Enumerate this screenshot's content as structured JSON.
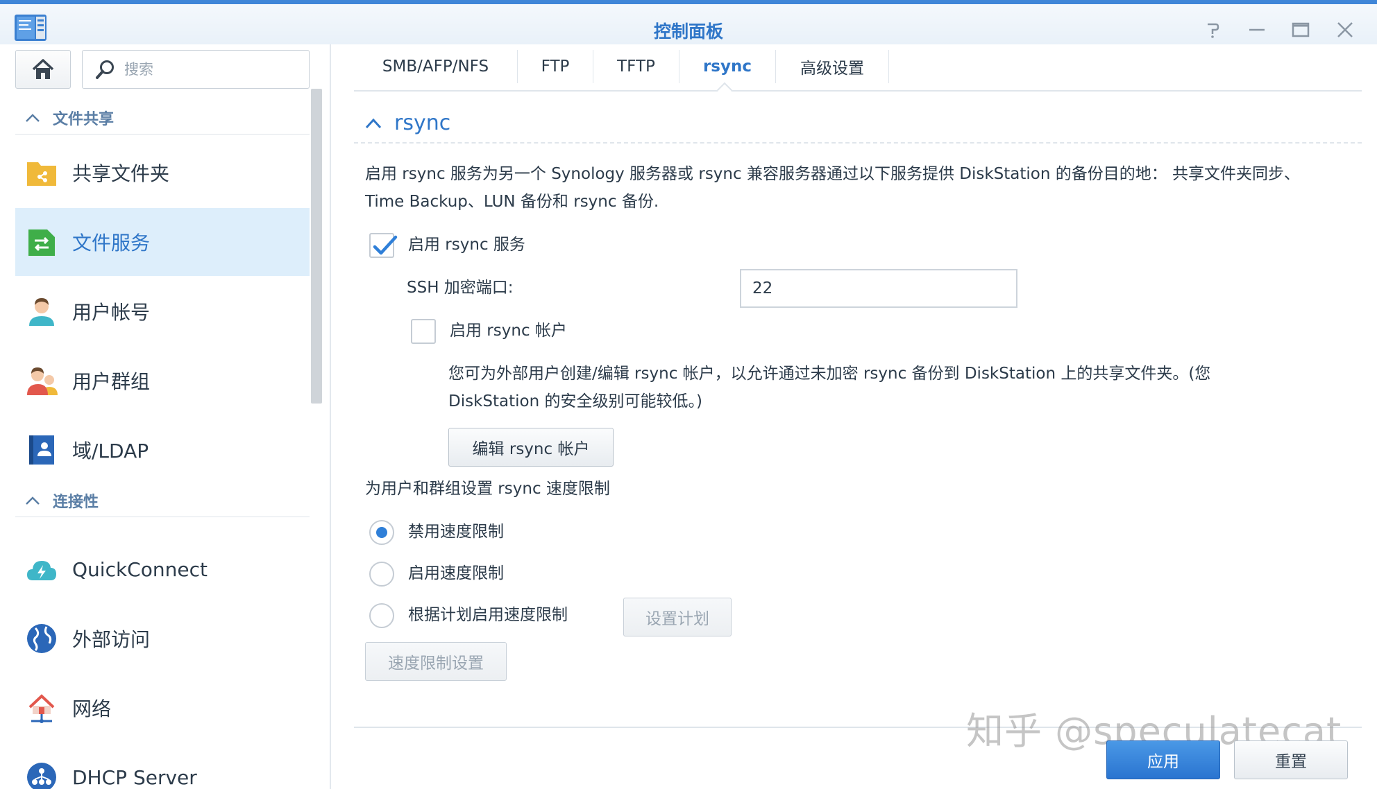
{
  "window": {
    "title": "控制面板"
  },
  "sidebar": {
    "search_placeholder": "搜索",
    "sections": [
      {
        "title": "文件共享",
        "items": [
          {
            "label": "共享文件夹",
            "icon": "shared-folder-icon"
          },
          {
            "label": "文件服务",
            "icon": "file-services-icon",
            "active": true
          },
          {
            "label": "用户帐号",
            "icon": "user-icon"
          },
          {
            "label": "用户群组",
            "icon": "group-icon"
          },
          {
            "label": "域/LDAP",
            "icon": "domain-ldap-icon"
          }
        ]
      },
      {
        "title": "连接性",
        "items": [
          {
            "label": "QuickConnect",
            "icon": "quickconnect-icon"
          },
          {
            "label": "外部访问",
            "icon": "globe-icon"
          },
          {
            "label": "网络",
            "icon": "network-icon"
          },
          {
            "label": "DHCP Server",
            "icon": "dhcp-icon"
          }
        ]
      }
    ]
  },
  "tabs": [
    {
      "label": "SMB/AFP/NFS"
    },
    {
      "label": "FTP"
    },
    {
      "label": "TFTP"
    },
    {
      "label": "rsync",
      "active": true
    },
    {
      "label": "高级设置"
    }
  ],
  "rsync": {
    "section_title": "rsync",
    "description_line1": "启用 rsync 服务为另一个 Synology 服务器或 rsync 兼容服务器通过以下服务提供 DiskStation 的备份目的地： 共享文件夹同步、",
    "description_line2": "Time Backup、LUN 备份和 rsync 备份.",
    "enable_service_label": "启用 rsync 服务",
    "enable_service_checked": true,
    "ssh_port_label": "SSH 加密端口:",
    "ssh_port_value": "22",
    "enable_account_label": "启用 rsync 帐户",
    "enable_account_checked": false,
    "account_note_line1": "您可为外部用户创建/编辑 rsync 帐户，以允许通过未加密 rsync 备份到 DiskStation 上的共享文件夹。(您",
    "account_note_line2": "DiskStation 的安全级别可能较低。)",
    "edit_account_button": "编辑 rsync 帐户",
    "speed_limit_heading": "为用户和群组设置 rsync 速度限制",
    "speed_options": [
      {
        "label": "禁用速度限制",
        "selected": true
      },
      {
        "label": "启用速度限制",
        "selected": false
      },
      {
        "label": "根据计划启用速度限制",
        "selected": false
      }
    ],
    "set_schedule_button": "设置计划",
    "speed_settings_button": "速度限制设置"
  },
  "footer": {
    "apply_button": "应用",
    "reset_button": "重置"
  },
  "watermark": "知乎 @speculatecat",
  "colors": {
    "accent": "#2f76c8",
    "active_nav_bg": "#ddeefb",
    "primary_button": "#2a74d0"
  }
}
